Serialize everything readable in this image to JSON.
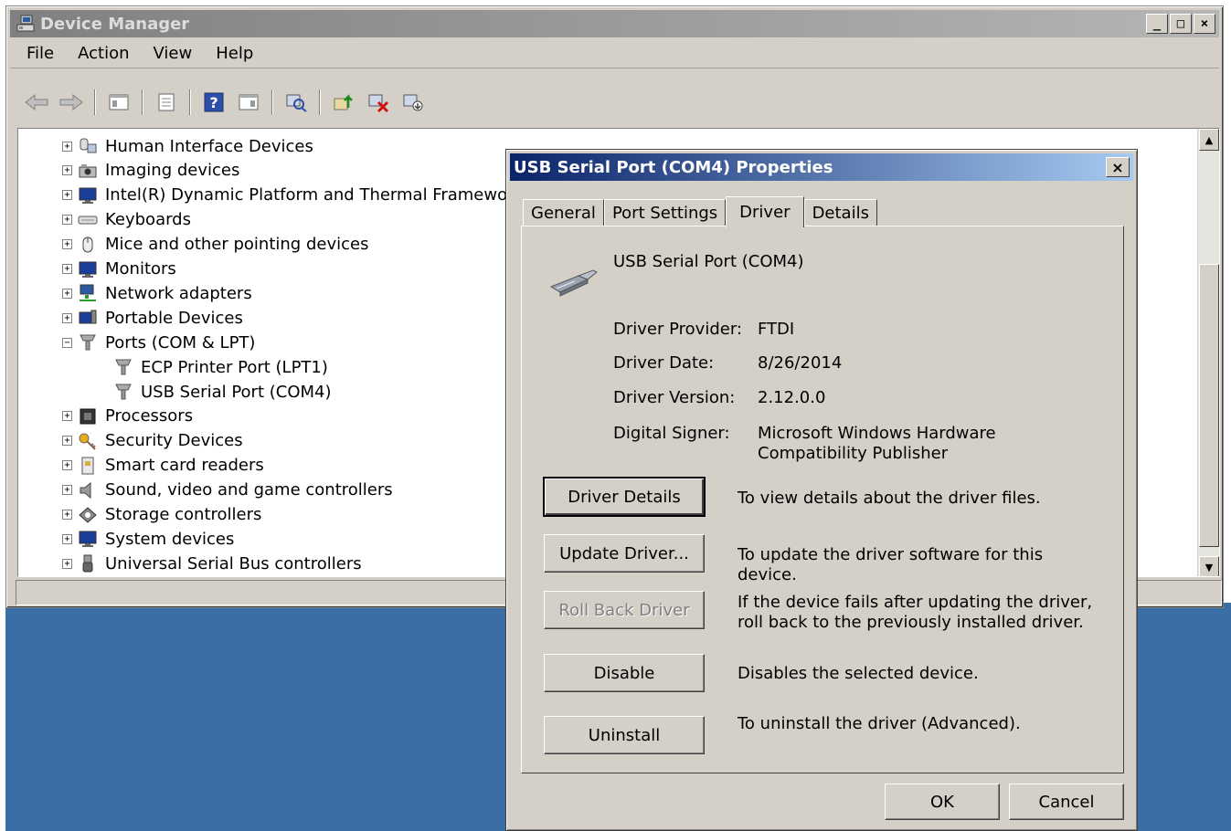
{
  "device_manager": {
    "title": "Device Manager",
    "window_controls": {
      "minimize": "_",
      "maximize": "□",
      "close": "×"
    },
    "menu": [
      "File",
      "Action",
      "View",
      "Help"
    ],
    "tree": [
      {
        "label": "Human Interface Devices",
        "icon": "hid-icon",
        "expander": "+"
      },
      {
        "label": "Imaging devices",
        "icon": "camera-icon",
        "expander": "+"
      },
      {
        "label": "Intel(R) Dynamic Platform and Thermal Framework",
        "icon": "monitor-icon",
        "expander": "+"
      },
      {
        "label": "Keyboards",
        "icon": "keyboard-icon",
        "expander": "+"
      },
      {
        "label": "Mice and other pointing devices",
        "icon": "mouse-icon",
        "expander": "+"
      },
      {
        "label": "Monitors",
        "icon": "monitor-icon",
        "expander": "+"
      },
      {
        "label": "Network adapters",
        "icon": "network-icon",
        "expander": "+"
      },
      {
        "label": "Portable Devices",
        "icon": "portable-device-icon",
        "expander": "+"
      },
      {
        "label": "Ports (COM & LPT)",
        "icon": "port-icon",
        "expander": "−"
      },
      {
        "label": "ECP Printer Port (LPT1)",
        "icon": "port-icon"
      },
      {
        "label": "USB Serial Port (COM4)",
        "icon": "port-icon"
      },
      {
        "label": "Processors",
        "icon": "processor-icon",
        "expander": "+"
      },
      {
        "label": "Security Devices",
        "icon": "key-icon",
        "expander": "+"
      },
      {
        "label": "Smart card readers",
        "icon": "smartcard-icon",
        "expander": "+"
      },
      {
        "label": "Sound, video and game controllers",
        "icon": "speaker-icon",
        "expander": "+"
      },
      {
        "label": "Storage controllers",
        "icon": "storage-icon",
        "expander": "+"
      },
      {
        "label": "System devices",
        "icon": "monitor-icon",
        "expander": "+"
      },
      {
        "label": "Universal Serial Bus controllers",
        "icon": "usb-icon",
        "expander": "+"
      }
    ]
  },
  "dialog": {
    "title": "USB Serial Port (COM4) Properties",
    "close": "×",
    "tabs": [
      "General",
      "Port Settings",
      "Driver",
      "Details"
    ],
    "active_tab": "Driver",
    "device_name": "USB Serial Port (COM4)",
    "properties": {
      "provider_label": "Driver Provider:",
      "provider_value": "FTDI",
      "date_label": "Driver Date:",
      "date_value": "8/26/2014",
      "version_label": "Driver Version:",
      "version_value": "2.12.0.0",
      "signer_label": "Digital Signer:",
      "signer_value": "Microsoft Windows Hardware Compatibility Publisher"
    },
    "buttons": {
      "driver_details": "Driver Details",
      "driver_details_desc": "To view details about the driver files.",
      "update_driver": "Update Driver...",
      "update_driver_desc": "To update the driver software for this device.",
      "roll_back": "Roll Back Driver",
      "roll_back_desc": "If the device fails after updating the driver, roll back to the previously installed driver.",
      "disable": "Disable",
      "disable_desc": "Disables the selected device.",
      "uninstall": "Uninstall",
      "uninstall_desc": "To uninstall the driver (Advanced).",
      "ok": "OK",
      "cancel": "Cancel"
    }
  }
}
